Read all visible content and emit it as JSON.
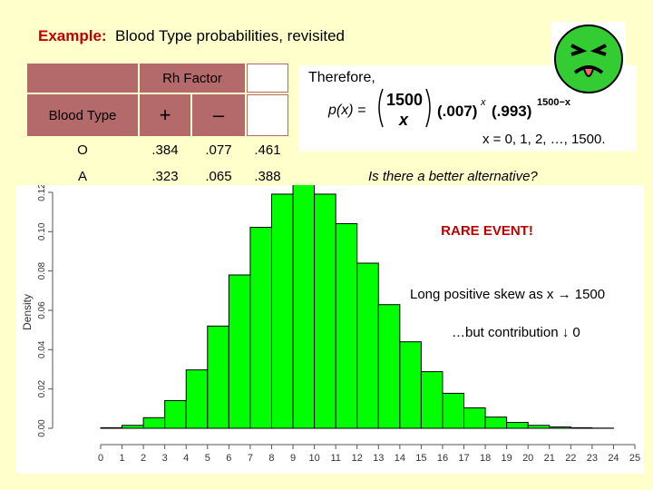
{
  "title": {
    "prefix": "Example:",
    "text": "Blood Type probabilities, revisited"
  },
  "table": {
    "rh_factor_label": "Rh Factor",
    "blood_type_label": "Blood Type",
    "plus": "+",
    "minus": "–",
    "rows": [
      {
        "type": "O",
        "pos": ".384",
        "neg": ".077",
        "total": ".461"
      },
      {
        "type": "A",
        "pos": ".323",
        "neg": ".065",
        "total": ".388"
      }
    ]
  },
  "formula": {
    "therefore": "Therefore,",
    "px": "p(x) =",
    "n": "1500",
    "k": "x",
    "p_term": "(.007)",
    "p_exp": "x",
    "q_term": "(.993)",
    "q_exp": "1500−x",
    "range": "x = 0, 1, 2, …, 1500."
  },
  "question": "Is there a better alternative?",
  "annotations": {
    "rare": "RARE EVENT!",
    "skew": "Long positive skew as x → 1500",
    "contribution": "…but contribution ↓ 0"
  },
  "colors": {
    "bar_fill": "#00ff00",
    "bar_stroke": "#000000",
    "accent": "#c00000",
    "background": "#ffffcc"
  },
  "chart_data": {
    "type": "bar",
    "title": "",
    "xlabel": "",
    "ylabel": "Density",
    "xlim": [
      0,
      25
    ],
    "ylim": [
      0,
      0.12
    ],
    "x_ticks": [
      "0",
      "1",
      "2",
      "3",
      "4",
      "5",
      "6",
      "7",
      "8",
      "9",
      "10",
      "11",
      "12",
      "13",
      "14",
      "15",
      "16",
      "17",
      "18",
      "19",
      "20",
      "21",
      "22",
      "23",
      "24",
      "25"
    ],
    "y_ticks": [
      "0.00",
      "0.02",
      "0.04",
      "0.06",
      "0.08",
      "0.10",
      "0.12"
    ],
    "categories": [
      "0",
      "1",
      "2",
      "3",
      "4",
      "5",
      "6",
      "7",
      "8",
      "9",
      "10",
      "11",
      "12",
      "13",
      "14",
      "15",
      "16",
      "17",
      "18",
      "19",
      "20",
      "21",
      "22",
      "23",
      "24",
      "25"
    ],
    "values": [
      0.0,
      0.0003,
      0.0015,
      0.0054,
      0.0141,
      0.0297,
      0.052,
      0.078,
      0.1022,
      0.1191,
      0.1249,
      0.1191,
      0.1041,
      0.084,
      0.0629,
      0.044,
      0.0288,
      0.0178,
      0.0104,
      0.0057,
      0.003,
      0.0015,
      0.0007,
      0.0003,
      0.0001,
      0.0
    ],
    "grid": false,
    "legend": "none"
  }
}
